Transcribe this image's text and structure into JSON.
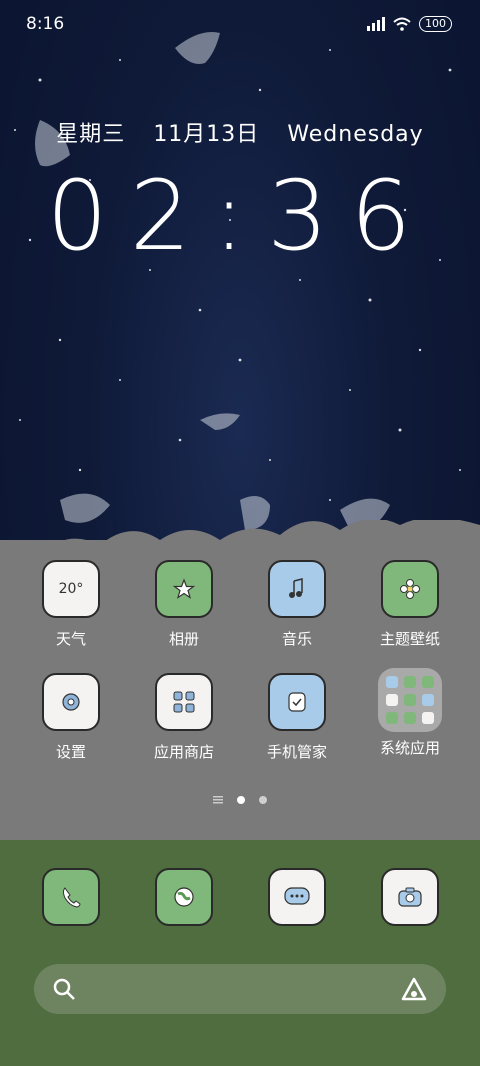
{
  "status_bar": {
    "time": "8:16",
    "battery": "100"
  },
  "lock": {
    "weekday": "星期三",
    "date": "11月13日",
    "weekday_en": "Wednesday",
    "clock": "02:36"
  },
  "apps_row1": [
    {
      "label": "天气",
      "icon": "weather-icon",
      "text": "20°"
    },
    {
      "label": "相册",
      "icon": "star-icon"
    },
    {
      "label": "音乐",
      "icon": "music-icon"
    },
    {
      "label": "主题壁纸",
      "icon": "flower-icon"
    }
  ],
  "apps_row2": [
    {
      "label": "设置",
      "icon": "gear-icon"
    },
    {
      "label": "应用商店",
      "icon": "store-icon"
    },
    {
      "label": "手机管家",
      "icon": "shield-icon"
    },
    {
      "label": "系统应用",
      "icon": "folder-icon"
    }
  ],
  "dock": [
    {
      "name": "phone",
      "icon": "phone-icon"
    },
    {
      "name": "browser",
      "icon": "globe-icon"
    },
    {
      "name": "messages",
      "icon": "message-icon"
    },
    {
      "name": "camera",
      "icon": "camera-icon"
    }
  ],
  "page_indicator": {
    "pages": 2,
    "current": 1
  },
  "colors": {
    "night_sky": "#0f1a38",
    "cloud_gray": "#7a7a7a",
    "grass_green": "#4f6d3f",
    "icon_green": "#7fb87a",
    "icon_blue": "#a7cbe8"
  }
}
